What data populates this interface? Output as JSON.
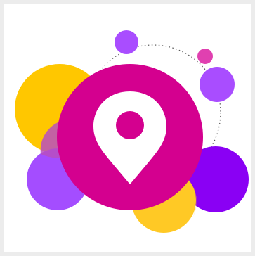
{
  "illustration": {
    "icon": "location-pin-icon",
    "colors": {
      "page_background": "#ececec",
      "frame_background": "#ffffff",
      "yellow": "#ffc700",
      "yellow_light": "#ffc925",
      "purple": "#a44dff",
      "violet": "#8a00f4",
      "magenta": "#d4008f",
      "pink": "#e040b0",
      "lavender": "#a94dff",
      "orange_overlap": "#e8a23a",
      "pin_white": "#ffffff",
      "dotted_ring": "#555555"
    }
  }
}
